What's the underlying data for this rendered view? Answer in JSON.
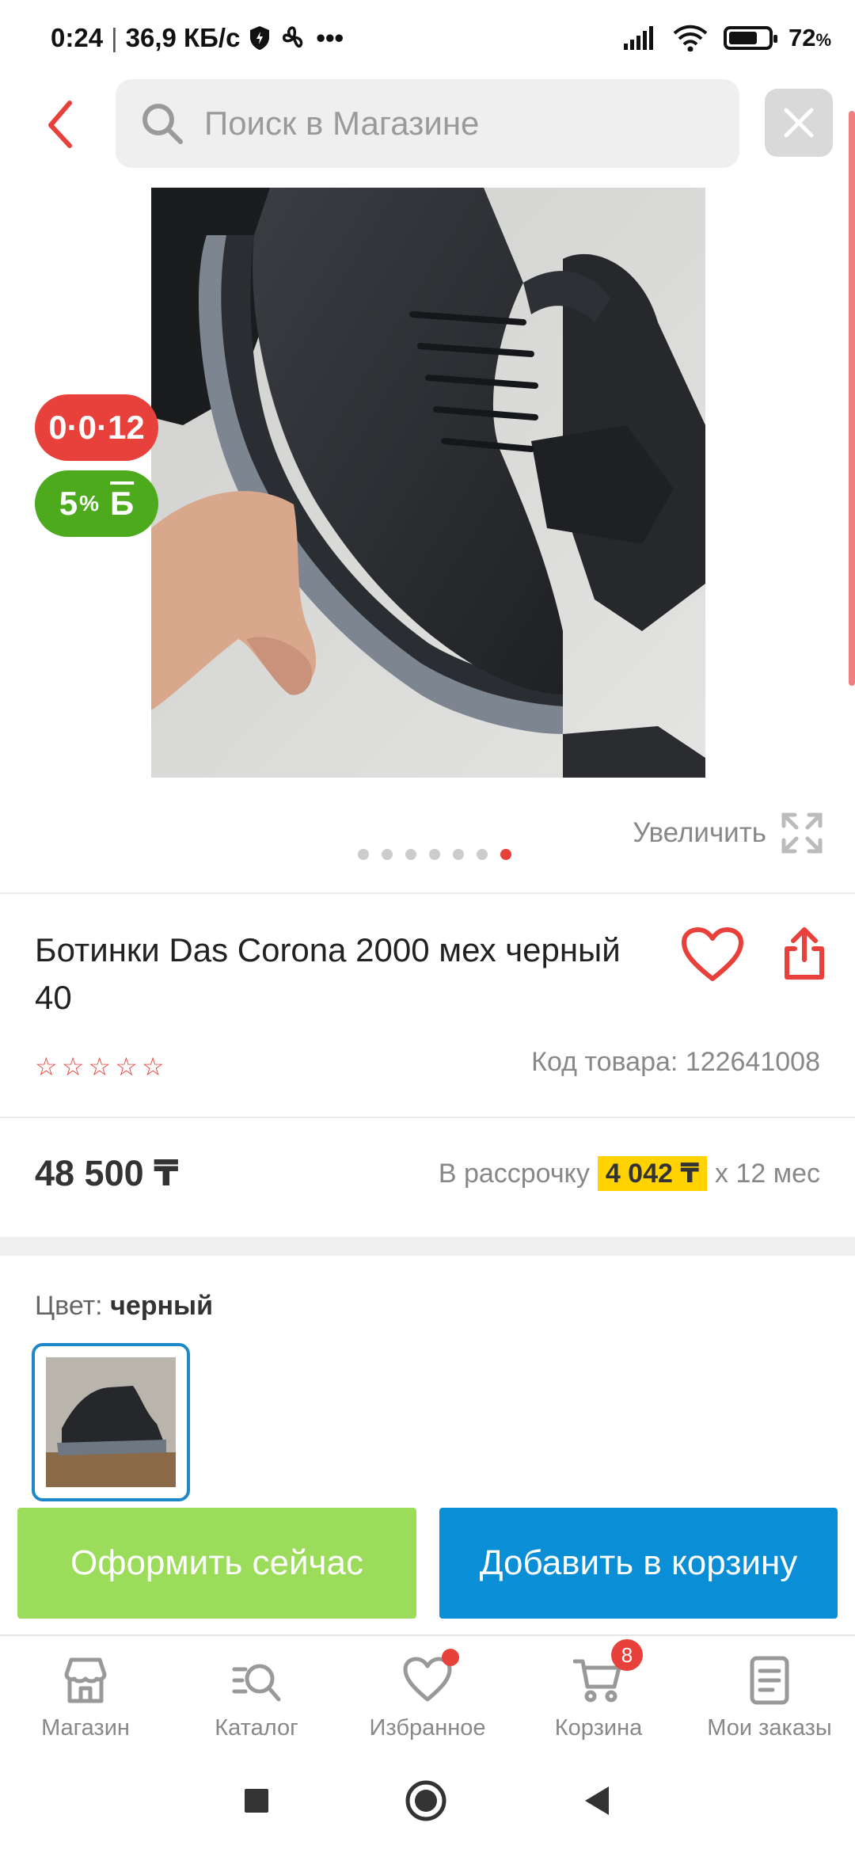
{
  "status_bar": {
    "time": "0:24",
    "speed": "36,9 КБ/с",
    "battery": "72",
    "battery_unit": "%",
    "battery_level": 0.72
  },
  "search": {
    "placeholder": "Поиск в Магазине"
  },
  "badges": {
    "installment": "0·0·12",
    "bonus_value": "5",
    "bonus_unit": "%",
    "bonus_letter": "Б"
  },
  "gallery": {
    "zoom_label": "Увеличить",
    "image_count": 7,
    "active_index": 6
  },
  "product": {
    "title": "Ботинки Das Corona 2000 мех черный 40",
    "rating_stars": 5,
    "rating_value": 0,
    "sku_label": "Код товара:",
    "sku_value": "122641008",
    "price": "48 500 ₸",
    "installment_label": "В рассрочку",
    "installment_amount": "4 042 ₸",
    "installment_term": "x 12 мес"
  },
  "color": {
    "label": "Цвет:",
    "value": "черный"
  },
  "actions": {
    "buy_now": "Оформить сейчас",
    "add_to_cart": "Добавить в корзину"
  },
  "bottom_nav": {
    "items": [
      {
        "label": "Магазин",
        "icon": "store-icon"
      },
      {
        "label": "Каталог",
        "icon": "catalog-search-icon"
      },
      {
        "label": "Избранное",
        "icon": "heart-icon"
      },
      {
        "label": "Корзина",
        "icon": "cart-icon"
      },
      {
        "label": "Мои заказы",
        "icon": "orders-icon"
      }
    ],
    "cart_count": "8"
  },
  "colors": {
    "accent_red": "#e8403a",
    "buy_green": "#9bdc5a",
    "cart_blue": "#0a8ed6",
    "highlight_yellow": "#ffd200"
  }
}
